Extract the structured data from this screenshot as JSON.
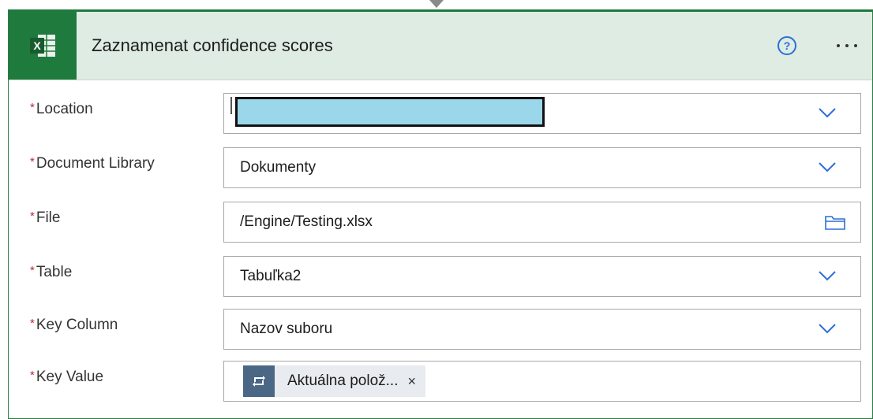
{
  "action": {
    "title": "Zaznamenat confidence scores",
    "app_icon": "excel-icon",
    "help_glyph": "?",
    "more_glyph": "..."
  },
  "fields": {
    "location": {
      "label": "Location",
      "required_mark": "*",
      "value": "",
      "control": "dropdown"
    },
    "document_library": {
      "label": "Document Library",
      "required_mark": "*",
      "value": "Dokumenty",
      "control": "dropdown"
    },
    "file": {
      "label": "File",
      "required_mark": "*",
      "value": "/Engine/Testing.xlsx",
      "control": "file-picker"
    },
    "table": {
      "label": "Table",
      "required_mark": "*",
      "value": "Tabuľka2",
      "control": "dropdown"
    },
    "key_column": {
      "label": "Key Column",
      "required_mark": "*",
      "value": "Nazov suboru",
      "control": "dropdown"
    },
    "key_value": {
      "label": "Key Value",
      "required_mark": "*",
      "token_text": "Aktuálna polož...",
      "token_close": "×",
      "token_icon": "loop-icon"
    }
  },
  "colors": {
    "excel_green": "#1f7a3d",
    "header_bg": "#dfece3",
    "accent_blue": "#2b6fd6",
    "required_red": "#c4262e",
    "token_icon_bg": "#4a6785",
    "redaction_fill": "#9bd7ea"
  }
}
